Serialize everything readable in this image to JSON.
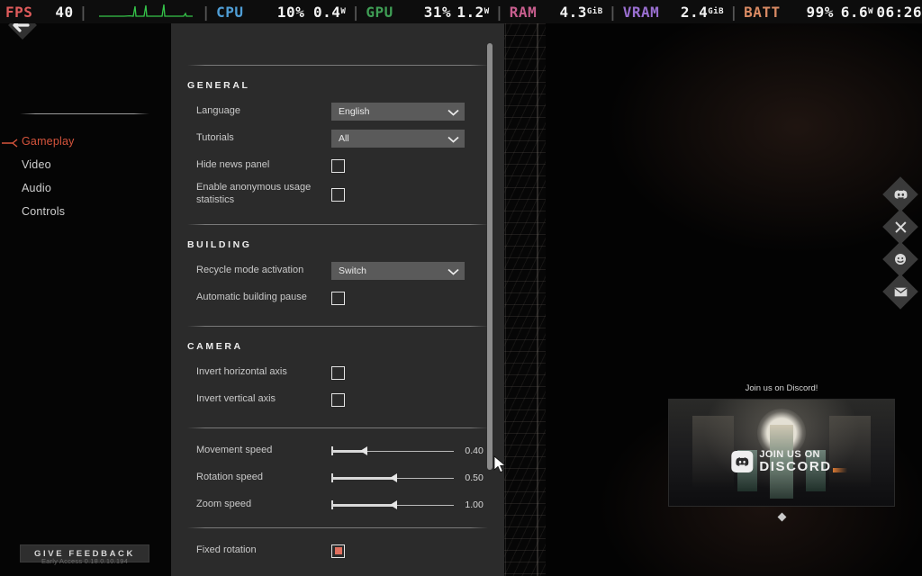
{
  "hud": {
    "fps_label": "FPS",
    "fps_value": "40",
    "cpu_label": "CPU",
    "cpu_value": "10%",
    "cpu_power": "0.4",
    "cpu_power_unit": "W",
    "gpu_label": "GPU",
    "gpu_value": "31%",
    "gpu_power": "1.2",
    "gpu_power_unit": "W",
    "ram_label": "RAM",
    "ram_value": "4.3",
    "ram_unit": "GiB",
    "vram_label": "VRAM",
    "vram_value": "2.4",
    "vram_unit": "GiB",
    "batt_label": "BATT",
    "batt_value": "99%",
    "batt_power": "6.6",
    "batt_power_unit": "W",
    "clock": "06:26",
    "separator": "|",
    "graph_color": "#35c54a"
  },
  "sidebar": {
    "back_icon": "back-arrow-icon",
    "items": [
      {
        "label": "Gameplay",
        "active": true
      },
      {
        "label": "Video",
        "active": false
      },
      {
        "label": "Audio",
        "active": false
      },
      {
        "label": "Controls",
        "active": false
      }
    ],
    "feedback_button": "GIVE FEEDBACK",
    "version": "Early Access 0.18.0.10.194",
    "active_color": "#d6543c"
  },
  "settings": {
    "sections": [
      {
        "title": "GENERAL",
        "rows": [
          {
            "label": "Language",
            "control": "dropdown",
            "value": "English"
          },
          {
            "label": "Tutorials",
            "control": "dropdown",
            "value": "All"
          },
          {
            "label": "Hide news panel",
            "control": "checkbox",
            "checked": false
          },
          {
            "label": "Enable anonymous usage statistics",
            "control": "checkbox",
            "checked": false
          }
        ]
      },
      {
        "title": "BUILDING",
        "rows": [
          {
            "label": "Recycle mode activation",
            "control": "dropdown",
            "value": "Switch"
          },
          {
            "label": "Automatic building pause",
            "control": "checkbox",
            "checked": false
          }
        ]
      },
      {
        "title": "CAMERA",
        "rows": [
          {
            "label": "Invert horizontal axis",
            "control": "checkbox",
            "checked": false
          },
          {
            "label": "Invert vertical axis",
            "control": "checkbox",
            "checked": false
          }
        ]
      }
    ],
    "sliders": [
      {
        "label": "Movement speed",
        "value": "0.40",
        "percent": 28
      },
      {
        "label": "Rotation speed",
        "value": "0.50",
        "percent": 53
      },
      {
        "label": "Zoom speed",
        "value": "1.00",
        "percent": 53
      }
    ],
    "fixed_rotation": {
      "label": "Fixed rotation",
      "control": "checkbox",
      "checked": true
    },
    "checked_color": "#e0705f"
  },
  "socials": [
    {
      "name": "discord-icon",
      "glyph": "◔"
    },
    {
      "name": "x-twitter-icon",
      "glyph": "✕"
    },
    {
      "name": "reddit-icon",
      "glyph": "◕"
    },
    {
      "name": "email-icon",
      "glyph": "✉"
    }
  ],
  "promo": {
    "title": "Join us on Discord!",
    "logo_line1": "JOIN US ON",
    "logo_line2": "DISCORD"
  }
}
